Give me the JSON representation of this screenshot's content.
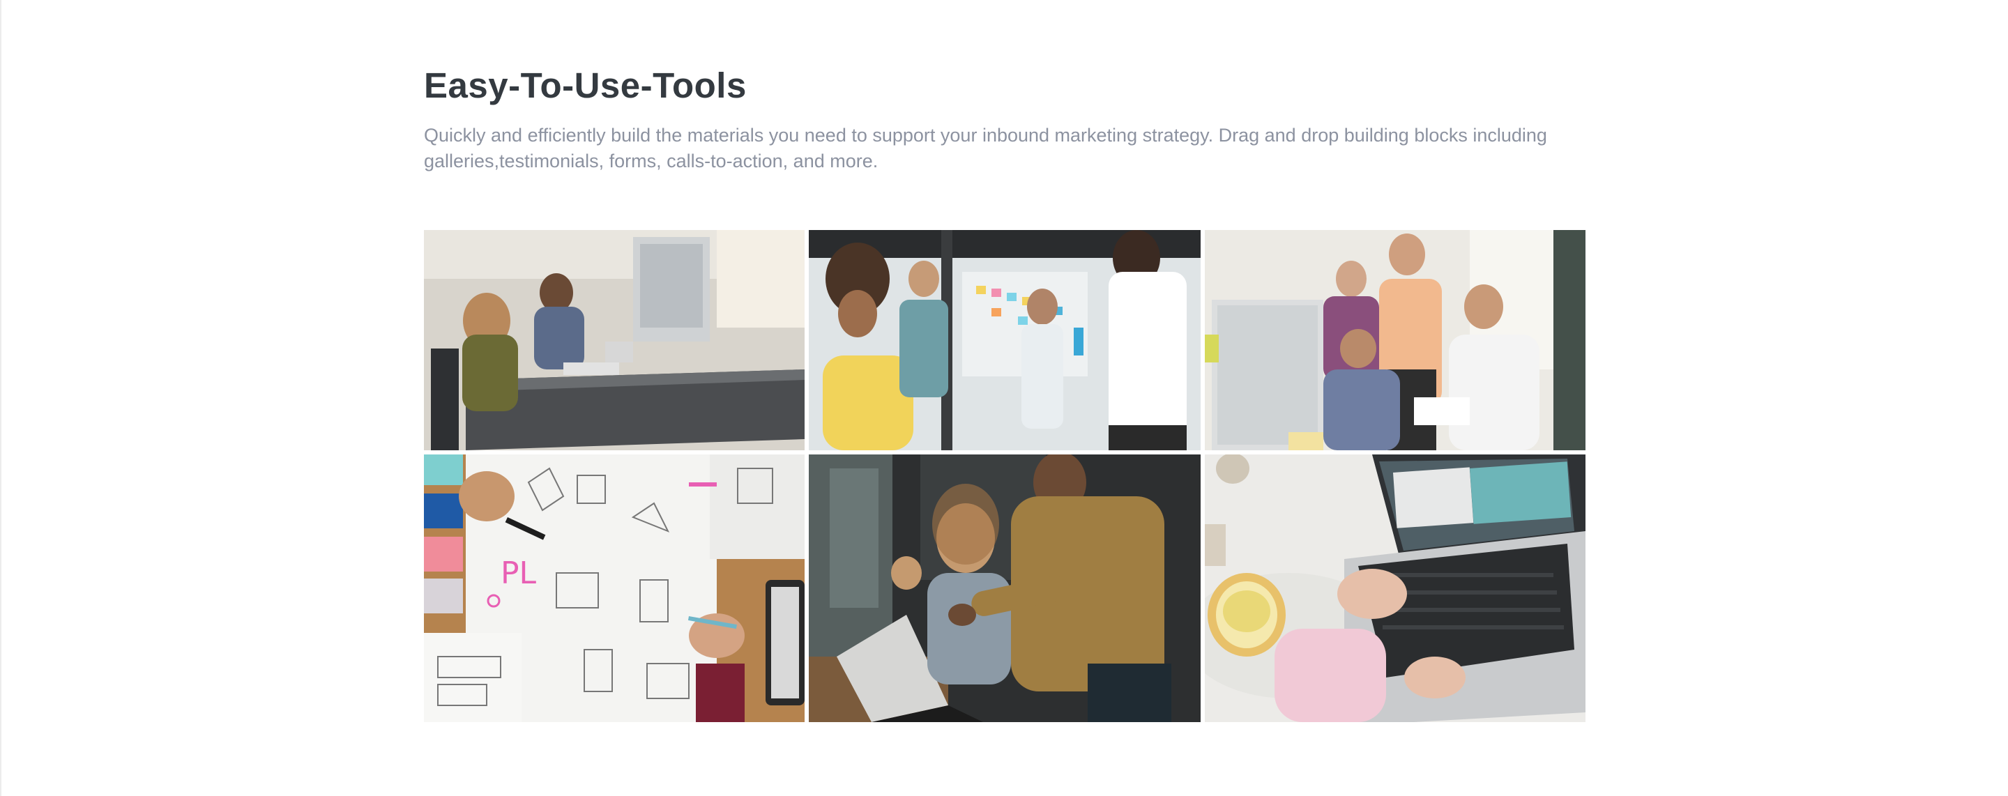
{
  "section": {
    "title": "Easy-To-Use-Tools",
    "description": "Quickly and efficiently build the materials you need to support your inbound marketing strategy. Drag and drop building blocks including galleries,testimonials, forms, calls-to-action, and more."
  },
  "gallery": {
    "images": [
      {
        "name": "coworkers-at-desk-photo"
      },
      {
        "name": "team-sticky-notes-photo"
      },
      {
        "name": "team-at-computer-photo"
      },
      {
        "name": "sketching-designs-photo"
      },
      {
        "name": "laptop-discussion-photo"
      },
      {
        "name": "typing-on-laptop-photo"
      }
    ]
  },
  "colors": {
    "title": "#343a40",
    "description": "#8c92a0",
    "background": "#ffffff"
  }
}
